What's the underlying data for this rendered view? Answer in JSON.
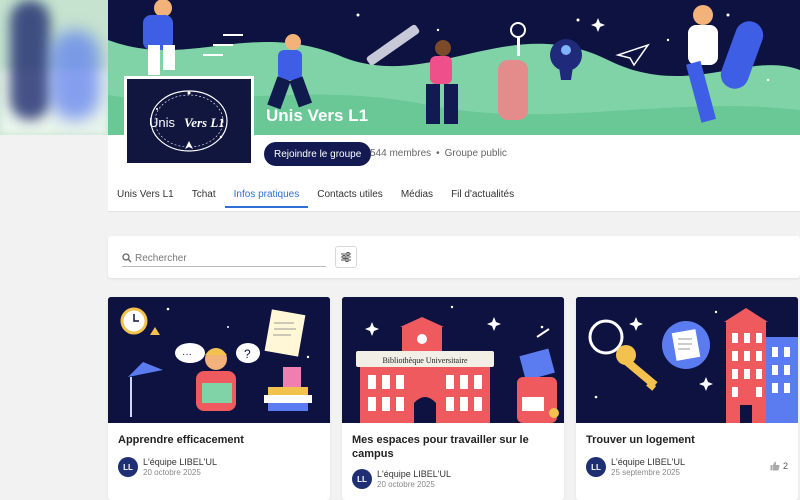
{
  "group": {
    "name": "Unis Vers L1",
    "logo_text_1": "Unis",
    "logo_text_2": "Vers L1",
    "join_label": "Rejoindre le groupe",
    "members": "544 membres",
    "separator": "•",
    "visibility": "Groupe public"
  },
  "tabs": [
    {
      "label": "Unis Vers L1",
      "active": false
    },
    {
      "label": "Tchat",
      "active": false
    },
    {
      "label": "Infos pratiques",
      "active": true
    },
    {
      "label": "Contacts utiles",
      "active": false
    },
    {
      "label": "Médias",
      "active": false
    },
    {
      "label": "Fil d'actualités",
      "active": false
    }
  ],
  "search": {
    "placeholder": "Rechercher",
    "value": ""
  },
  "cards": [
    {
      "title": "Apprendre efficacement",
      "author": "L'équipe LIBEL'UL",
      "avatar": "LL",
      "date": "20 octobre 2025",
      "likes": ""
    },
    {
      "title": "Mes espaces pour travailler sur le campus",
      "author": "L'équipe LIBEL'UL",
      "avatar": "LL",
      "date": "20 octobre 2025",
      "likes": "",
      "sign": "Bibliothèque Universitaire"
    },
    {
      "title": "Trouver un logement",
      "author": "L'équipe LIBEL'UL",
      "avatar": "LL",
      "date": "25 septembre 2025",
      "likes": "2"
    }
  ],
  "colors": {
    "banner_bg": "#0e1240",
    "banner_green": "#7fd3a6",
    "accent": "#2f6fd6",
    "button": "#131a52",
    "building_red": "#ef5a5f"
  }
}
